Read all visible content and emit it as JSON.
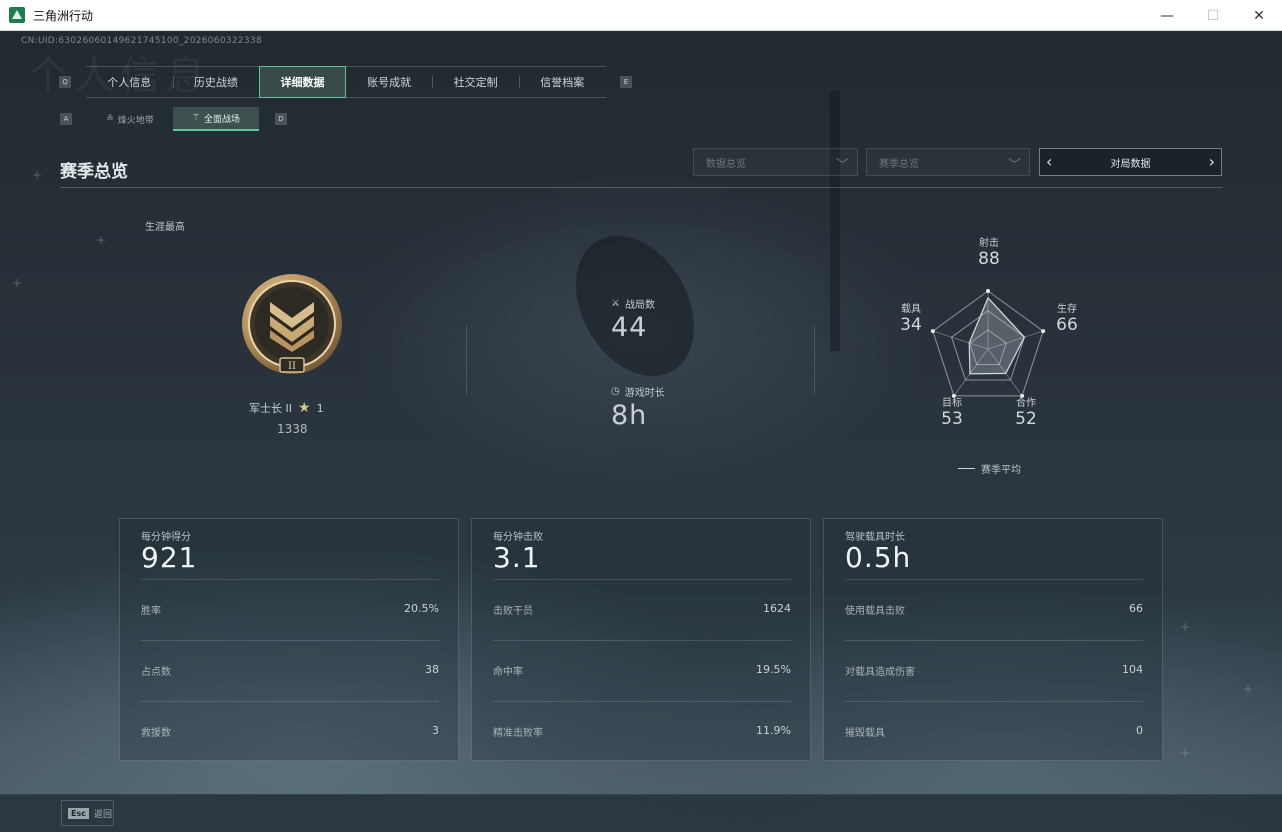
{
  "window": {
    "title": "三角洲行动",
    "minimize": "—",
    "maximize": "☐",
    "close": "✕"
  },
  "uid": "CN:UID:63026060149621745100_2026060322338",
  "tab_keys": {
    "left": "Q",
    "right": "E",
    "sub_left": "A",
    "sub_right": "D"
  },
  "main_tabs": [
    "个人信息",
    "历史战绩",
    "详细数据",
    "账号成就",
    "社交定制",
    "信誉档案"
  ],
  "active_main_tab": 2,
  "sub_tabs": [
    {
      "label": "烽火地带",
      "icon": "≗"
    },
    {
      "label": "全面战场",
      "icon": "⚚"
    }
  ],
  "active_sub_tab": 1,
  "section": {
    "title": "赛季总览",
    "dropdown1": "数据总览",
    "dropdown2": "赛季总览",
    "pager_label": "对局数据"
  },
  "rank": {
    "career_label": "生涯最高",
    "name": "军士长 II",
    "stars": "1",
    "score": "1338",
    "badge_numeral": "II"
  },
  "mid_stats": {
    "matches_label": "战局数",
    "matches": "44",
    "time_label": "游戏时长",
    "time": "8h"
  },
  "radar": {
    "axes": [
      {
        "name": "射击",
        "value": "88"
      },
      {
        "name": "生存",
        "value": "66"
      },
      {
        "name": "合作",
        "value": "52"
      },
      {
        "name": "目标",
        "value": "53"
      },
      {
        "name": "载具",
        "value": "34"
      }
    ],
    "legend": "赛季平均"
  },
  "cards": [
    {
      "title": "每分钟得分",
      "big": "921",
      "rows": [
        {
          "k": "胜率",
          "v": "20.5%"
        },
        {
          "k": "占点数",
          "v": "38"
        },
        {
          "k": "救援数",
          "v": "3"
        }
      ]
    },
    {
      "title": "每分钟击败",
      "big": "3.1",
      "rows": [
        {
          "k": "击败干员",
          "v": "1624"
        },
        {
          "k": "命中率",
          "v": "19.5%"
        },
        {
          "k": "精准击败率",
          "v": "11.9%"
        }
      ]
    },
    {
      "title": "驾驶载具时长",
      "big": "0.5h",
      "rows": [
        {
          "k": "使用载具击败",
          "v": "66"
        },
        {
          "k": "对载具造成伤害",
          "v": "104"
        },
        {
          "k": "摧毁载具",
          "v": "0"
        }
      ]
    }
  ],
  "footer": {
    "esc_key": "Esc",
    "esc_label": "返回"
  },
  "colors": {
    "accent": "#5bc69a",
    "background": "#1b232b",
    "badge_gold": "#c9a978"
  }
}
